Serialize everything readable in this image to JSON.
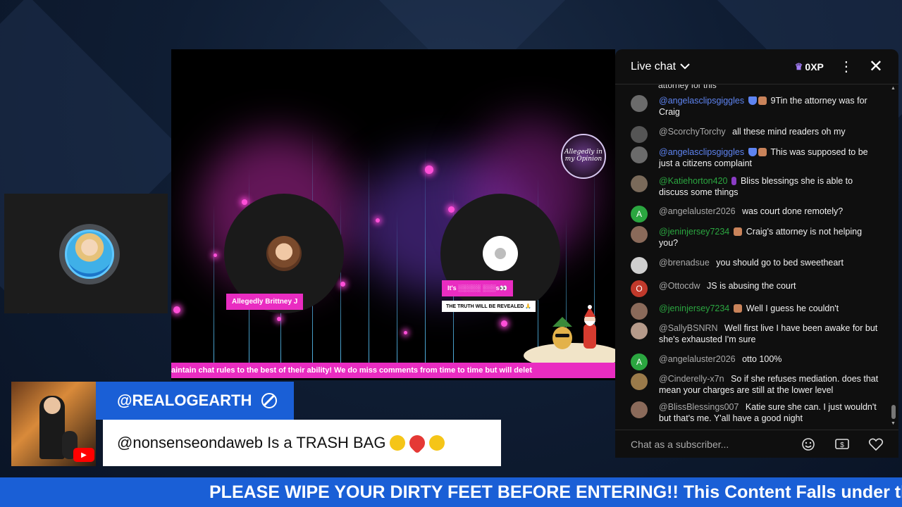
{
  "stream": {
    "guest1_name": "Allegedly Brittney J",
    "guest2_tag": "It's ░░░░░ ░░░s👀",
    "guest2_subtag": "THE TRUTH WILL BE REVEALED 🙏",
    "logo_text": "Allegedly in my Opinion",
    "inner_ticker": "aintain chat rules to the best of their ability! We do miss comments from time to time but will delet"
  },
  "chat": {
    "title": "Live chat",
    "xp_label": "0XP",
    "cutoff_text": "attorney for this",
    "input_placeholder": "Chat as a subscriber...",
    "messages": [
      {
        "author": "@angelasclipsgiggles",
        "text": "9Tin the attorney was for Craig",
        "avatar_color": "#6b6b6b",
        "avatar_letter": "",
        "author_style": "blue"
      },
      {
        "author": "@ScorchyTorchy",
        "text": "all these mind readers oh my",
        "avatar_color": "#555555",
        "avatar_letter": "",
        "author_style": "plain"
      },
      {
        "author": "@angelasclipsgiggles",
        "text": "This was supposed to be just a citizens complaint",
        "avatar_color": "#6b6b6b",
        "avatar_letter": "",
        "author_style": "blue"
      },
      {
        "author": "@Katiehorton420",
        "text": "Bliss blessings she is able to discuss some things",
        "avatar_color": "#7a6a5a",
        "avatar_letter": "",
        "author_style": "member"
      },
      {
        "author": "@angelaluster2026",
        "text": "was court done remotely?",
        "avatar_color": "#2ba640",
        "avatar_letter": "A",
        "author_style": "plain"
      },
      {
        "author": "@jeninjersey7234",
        "text": "Craig's attorney is not helping you?",
        "avatar_color": "#8a6a5a",
        "avatar_letter": "",
        "author_style": "member"
      },
      {
        "author": "@brenadsue",
        "text": "you should go to bed sweetheart",
        "avatar_color": "#cfcfcf",
        "avatar_letter": "",
        "author_style": "plain"
      },
      {
        "author": "@Ottocdw",
        "text": "JS is abusing the court",
        "avatar_color": "#c0392b",
        "avatar_letter": "O",
        "author_style": "plain"
      },
      {
        "author": "@jeninjersey7234",
        "text": "Well I guess he couldn't",
        "avatar_color": "#8a6a5a",
        "avatar_letter": "",
        "author_style": "member"
      },
      {
        "author": "@SallyBSNRN",
        "text": "Well first live I have been awake for but she's exhausted I'm sure",
        "avatar_color": "#b59a8a",
        "avatar_letter": "",
        "author_style": "plain"
      },
      {
        "author": "@angelaluster2026",
        "text": "otto 100%",
        "avatar_color": "#2ba640",
        "avatar_letter": "A",
        "author_style": "plain"
      },
      {
        "author": "@Cinderelly-x7n",
        "text": "So if she refuses mediation. does that mean your charges are still at the lower level",
        "avatar_color": "#9a7a4a",
        "avatar_letter": "",
        "author_style": "plain"
      },
      {
        "author": "@BlissBlessings007",
        "text": "Katie sure she can. I just wouldn't but that's me. Y'all have a good night",
        "avatar_color": "#8a6a5a",
        "avatar_letter": "",
        "author_style": "plain"
      }
    ]
  },
  "featured": {
    "username": "@REALOGEARTH",
    "message": "@nonsenseondaweb Is a TRASH BAG"
  },
  "ticker": {
    "text": "PLEASE WIPE YOUR DIRTY FEET BEFORE ENTERING!! This Content Falls under th"
  },
  "icons": {
    "chevron": "chevron-down-icon",
    "crown": "crown-icon",
    "kebab": "more-vert-icon",
    "close": "close-icon",
    "emoji": "emoji-icon",
    "superchat": "super-chat-icon",
    "heart": "heart-icon",
    "blocked": "block-icon"
  },
  "colors": {
    "accent_blue": "#1a5fd6",
    "pink": "#e92cc1",
    "member_green": "#2ba640"
  }
}
